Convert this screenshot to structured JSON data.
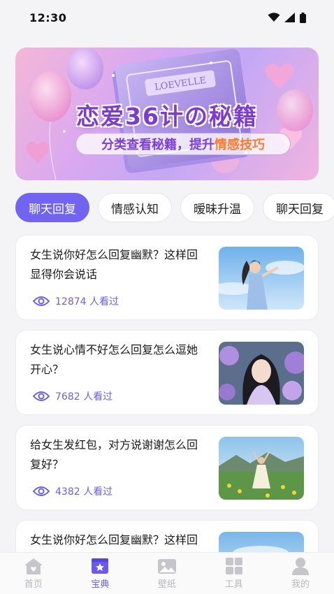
{
  "status": {
    "time": "12:30"
  },
  "banner": {
    "title": "恋爱36计の秘籍",
    "subtitle_prefix": "分类查看秘籍，提升",
    "subtitle_highlight": "情感技巧",
    "book_text": "LOEVELLE"
  },
  "tabs": [
    {
      "label": "聊天回复",
      "active": true
    },
    {
      "label": "情感认知",
      "active": false
    },
    {
      "label": "暧昧升温",
      "active": false
    },
    {
      "label": "聊天回复",
      "active": false
    }
  ],
  "cards": [
    {
      "title": "女生说你好怎么回复幽默？这样回显得你会说话",
      "views": "12874 人看过"
    },
    {
      "title": "女生说心情不好怎么回复怎么逗她开心？",
      "views": "7682 人看过"
    },
    {
      "title": "给女生发红包，对方说谢谢怎么回复好？",
      "views": "4382 人看过"
    },
    {
      "title": "女生说你好怎么回复幽默？这样回显得你会说话",
      "views": ""
    }
  ],
  "nav": [
    {
      "label": "首页",
      "icon": "home-icon",
      "active": false
    },
    {
      "label": "宝典",
      "icon": "book-star-icon",
      "active": true
    },
    {
      "label": "壁纸",
      "icon": "image-icon",
      "active": false
    },
    {
      "label": "工具",
      "icon": "grid-icon",
      "active": false
    },
    {
      "label": "我的",
      "icon": "user-icon",
      "active": false
    }
  ],
  "colors": {
    "accent": "#7264f1",
    "nav_active": "#6a5bea",
    "nav_inactive": "#b8b8be",
    "views_text": "#6b62d8",
    "banner_highlight": "#ff7b2d"
  }
}
